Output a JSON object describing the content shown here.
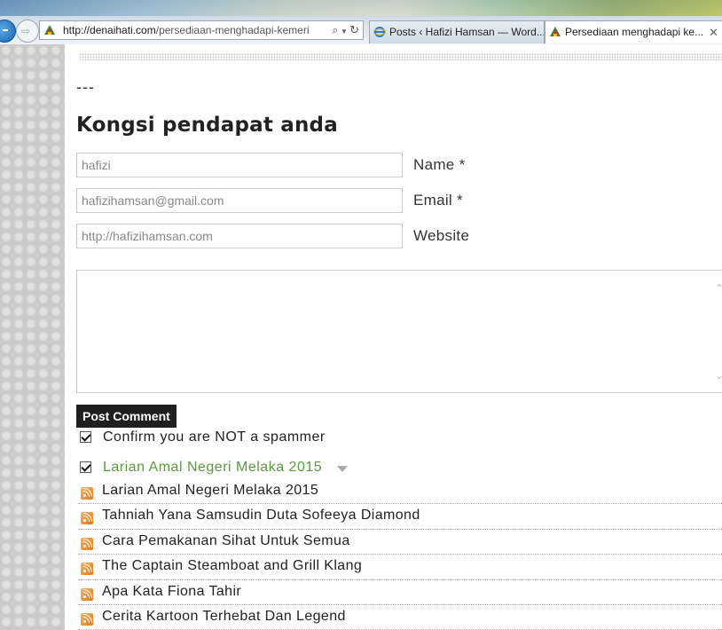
{
  "browser": {
    "address_domain": "http://denaihati.com",
    "address_path": "/persediaan-menghadapi-kemeri",
    "tabs": [
      {
        "label": "Posts ‹ Hafizi Hamsan — Word..."
      },
      {
        "label": "Persediaan menghadapi ke..."
      }
    ],
    "tab_close": "✕"
  },
  "page": {
    "separator": "---",
    "heading": "Kongsi pendapat anda",
    "form": {
      "name": {
        "value": "hafizi",
        "label": "Name *"
      },
      "email": {
        "value": "hafizihamsan@gmail.com",
        "label": "Email *"
      },
      "website": {
        "value": "http://hafizihamsan.com",
        "label": "Website"
      },
      "comment": {
        "value": ""
      },
      "submit_label": "Post Comment",
      "spam_check": {
        "label": "Confirm you are NOT a spammer",
        "checked": true
      },
      "notify_check": {
        "label": "Larian Amal Negeri Melaka 2015",
        "checked": true
      }
    },
    "recent_posts": [
      {
        "title": "Larian Amal Negeri Melaka 2015"
      },
      {
        "title": "Tahniah Yana Samsudin Duta Sofeeya Diamond"
      },
      {
        "title": "Cara Pemakanan Sihat Untuk Semua"
      },
      {
        "title": "The Captain Steamboat and Grill Klang"
      },
      {
        "title": "Apa Kata Fiona Tahir"
      },
      {
        "title": "Cerita Kartoon Terhebat Dan Legend"
      }
    ]
  },
  "colors": {
    "link_green": "#5a9a3c",
    "button_bg": "#1f1f1f",
    "rss_orange": "#e87818"
  },
  "icons": [
    "back-arrow-icon",
    "forward-arrow-icon",
    "site-favicon-icon",
    "search-icon",
    "dropdown-arrow-icon",
    "refresh-icon",
    "ie-icon",
    "close-icon",
    "rss-icon",
    "checkbox-icon"
  ]
}
